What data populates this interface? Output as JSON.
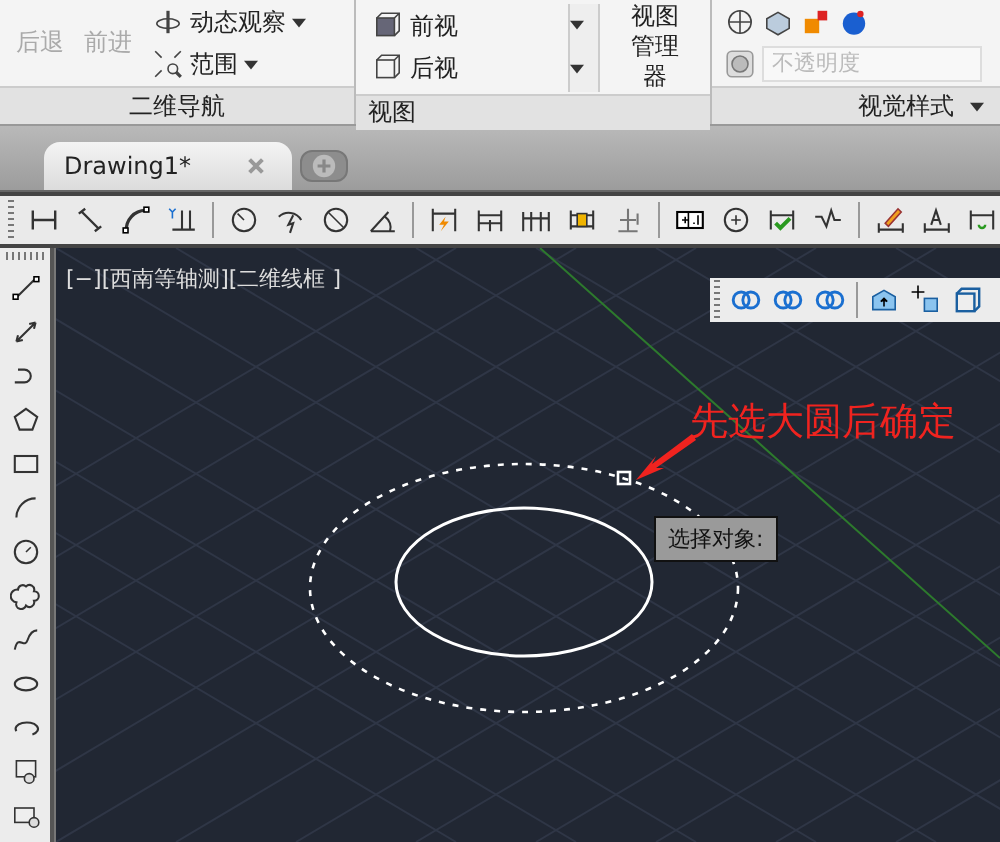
{
  "nav_panel": {
    "title": "二维导航",
    "history": [
      {
        "label": "后退",
        "disabled": true
      },
      {
        "label": "前进",
        "disabled": true
      }
    ],
    "tools": [
      {
        "label": "动态观察",
        "kind": "orbit"
      },
      {
        "label": "范围",
        "kind": "extents"
      }
    ]
  },
  "view_panel": {
    "title": "视图",
    "views": [
      "前视",
      "后视"
    ],
    "manager_lines": [
      "视图",
      "管理器"
    ]
  },
  "visual_panel": {
    "title": "视觉样式",
    "opacity_placeholder": "不透明度"
  },
  "document_tabs": [
    {
      "label": "Drawing1*",
      "selected": true
    }
  ],
  "viewport": {
    "controls": [
      "[−]",
      "[西南等轴测]",
      "[二维线框 ]"
    ],
    "annotation": "先选大圆后确定",
    "tooltip": "选择对象:"
  }
}
